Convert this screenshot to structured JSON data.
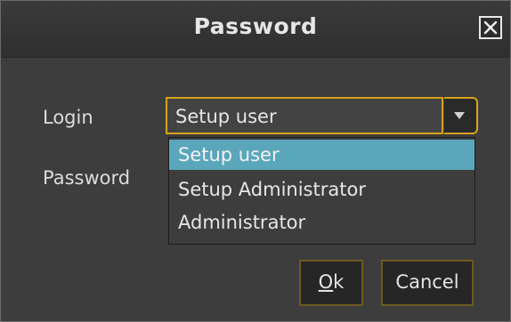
{
  "dialog": {
    "title": "Password",
    "close_icon": "close-icon"
  },
  "form": {
    "login_label": "Login",
    "password_label": "Password",
    "login_combo": {
      "selected": "Setup user",
      "arrow_icon": "chevron-down-icon",
      "options": [
        "Setup user",
        "Setup Administrator",
        "Administrator"
      ],
      "highlighted_index": 0
    }
  },
  "buttons": {
    "ok_mnemonic": "O",
    "ok_rest": "k",
    "cancel": "Cancel"
  },
  "colors": {
    "accent_border": "#d9a21a",
    "highlight": "#5aa7bc",
    "background": "#3d3d3d"
  }
}
